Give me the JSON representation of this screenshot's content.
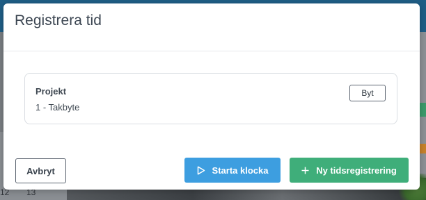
{
  "modal": {
    "title": "Registrera tid",
    "project": {
      "label": "Projekt",
      "value": "1 - Takbyte",
      "change_label": "Byt"
    },
    "footer": {
      "cancel_label": "Avbryt",
      "start_clock_label": "Starta klocka",
      "new_entry_label": "Ny tidsregistrering"
    }
  },
  "background": {
    "calendar_day_a": "12",
    "calendar_day_b": "13"
  },
  "colors": {
    "start_button": "#3d9ee0",
    "new_entry_button": "#3fae7a",
    "title_text": "#3c4652"
  },
  "icons": {
    "start": "play-icon",
    "new": "plus-icon"
  }
}
